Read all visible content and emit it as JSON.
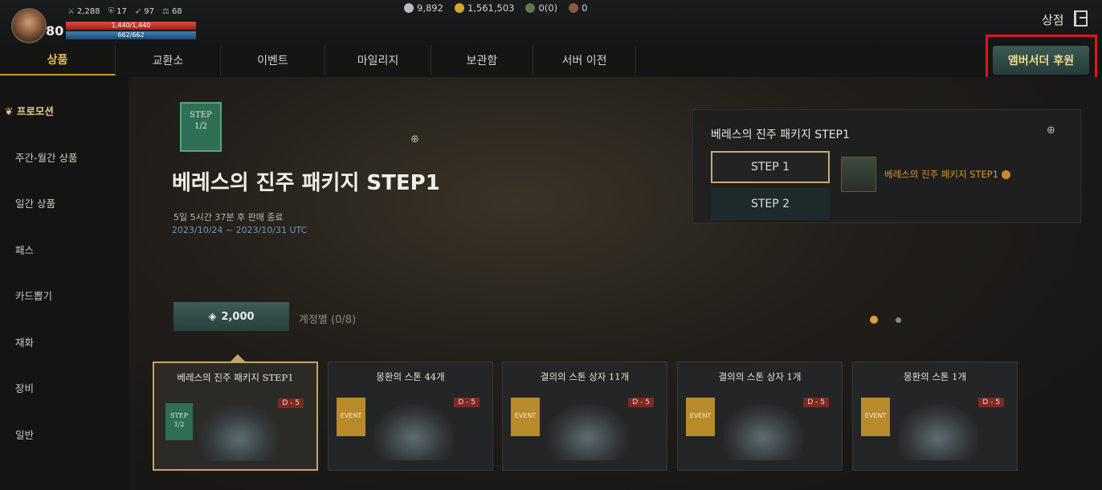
{
  "player": {
    "level": "80",
    "stats": [
      "2,288",
      "17",
      "97",
      "68"
    ],
    "hp": "1,440/1,440",
    "mp": "662/662"
  },
  "currency": [
    "9,892",
    "1,561,503",
    "0(0)",
    "0"
  ],
  "header": {
    "shop_label": "상점"
  },
  "tabs": [
    "상품",
    "교환소",
    "이벤트",
    "마일리지",
    "보관함",
    "서버 이전"
  ],
  "ember_button": "앰버서더 후원",
  "sidebar": [
    "프로모션",
    "주간-월간 상품",
    "일간 상품",
    "패스",
    "카드뽑기",
    "재화",
    "장비",
    "일반"
  ],
  "banner": {
    "flag_line1": "STEP",
    "flag_line2": "1/2",
    "title": "베레스의 진주 패키지 STEP1",
    "sale_end": "5일 5시간 37분 후 판매 종료",
    "date_range": "2023/10/24 ~ 2023/10/31 UTC",
    "price": "2,000",
    "limit": "계정별 (0/8)"
  },
  "panel": {
    "title": "베레스의 진주 패키지 STEP1",
    "steps": [
      "STEP 1",
      "STEP 2"
    ],
    "item_name": "베레스의 진주 패키지 STEP1"
  },
  "cards": [
    {
      "name": "베레스의 진주 패키지 STEP1",
      "tag": "D - 5",
      "badge": "STEP 1/2"
    },
    {
      "name": "몽환의 스톤 44개",
      "tag": "D - 5",
      "badge": "EVENT"
    },
    {
      "name": "결의의 스톤 상자 11개",
      "tag": "D - 5",
      "badge": "EVENT"
    },
    {
      "name": "결의의 스톤 상자 1개",
      "tag": "D - 5",
      "badge": "EVENT"
    },
    {
      "name": "몽환의 스톤 1개",
      "tag": "D - 5",
      "badge": "EVENT"
    }
  ]
}
